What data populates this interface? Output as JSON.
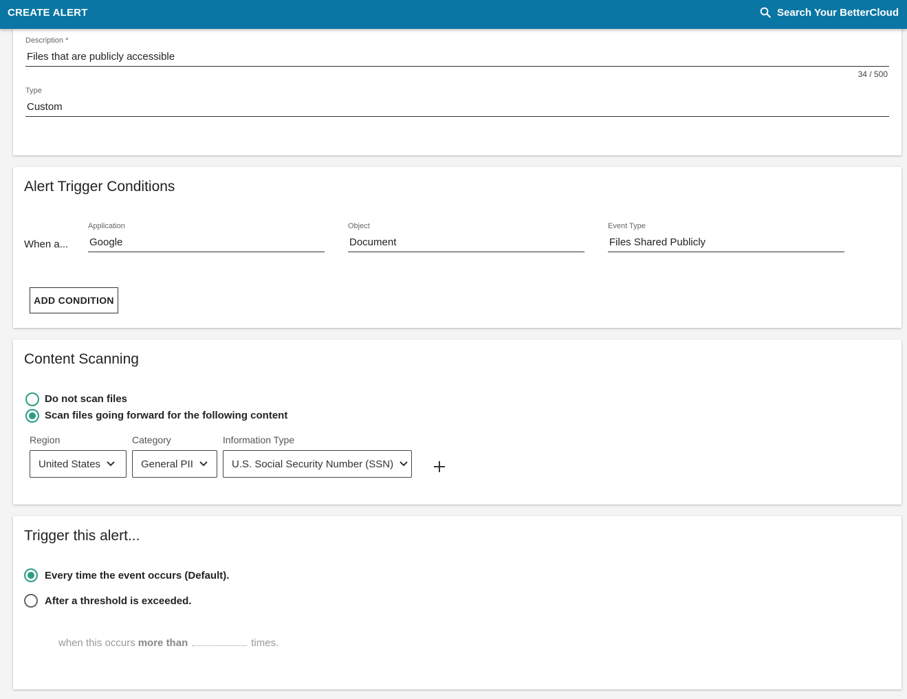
{
  "header": {
    "title": "CREATE ALERT",
    "search_label": "Search Your BetterCloud"
  },
  "details": {
    "description_label": "Description *",
    "description_value": "Files that are publicly accessible",
    "char_count": "34 / 500",
    "type_label": "Type",
    "type_value": "Custom"
  },
  "trigger_conditions": {
    "heading": "Alert Trigger Conditions",
    "when_label": "When a...",
    "application_label": "Application",
    "application_value": "Google",
    "object_label": "Object",
    "object_value": "Document",
    "event_type_label": "Event Type",
    "event_type_value": "Files Shared Publicly",
    "add_condition_label": "ADD CONDITION"
  },
  "content_scanning": {
    "heading": "Content Scanning",
    "option_no_scan": "Do not scan files",
    "option_scan": "Scan files going forward for the following content",
    "selected_option": "scan",
    "region_label": "Region",
    "region_value": "United States",
    "category_label": "Category",
    "category_value": "General PII",
    "info_type_label": "Information Type",
    "info_type_value": "U.S. Social Security Number (SSN)"
  },
  "trigger_alert": {
    "heading": "Trigger this alert...",
    "option_every_time": "Every time the event occurs (Default).",
    "option_threshold": "After a threshold is exceeded.",
    "selected_option": "every_time",
    "threshold_prefix": "when this occurs",
    "threshold_bold": "more than",
    "threshold_suffix": "times."
  },
  "colors": {
    "header_bg": "#0a76a3",
    "accent": "#2a9d83"
  }
}
